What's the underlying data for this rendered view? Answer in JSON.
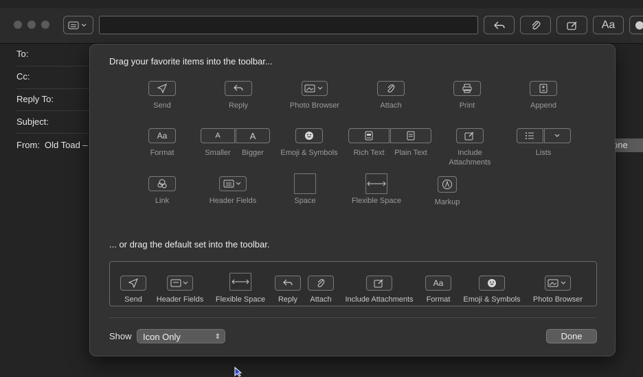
{
  "mail": {
    "headers": [
      {
        "label": "To:"
      },
      {
        "label": "Cc:"
      },
      {
        "label": "Reply To:"
      },
      {
        "label": "Subject:"
      },
      {
        "label": "From:",
        "value": "Old Toad –"
      }
    ],
    "right_partial": "one"
  },
  "sheet": {
    "title": "Drag your favorite items into the toolbar...",
    "items": [
      {
        "label": "Send",
        "icon": "send-icon"
      },
      {
        "label": "Reply",
        "icon": "reply-icon"
      },
      {
        "label": "Photo Browser",
        "icon": "photo-browser-icon"
      },
      {
        "label": "Attach",
        "icon": "paperclip-icon"
      },
      {
        "label": "Print",
        "icon": "printer-icon"
      },
      {
        "label": "Append",
        "icon": "append-icon"
      },
      {
        "label": "Format",
        "icon": "format-icon",
        "glyph": "Aa"
      },
      {
        "label": "Smaller",
        "icon": "smaller-font-icon",
        "glyph": "A"
      },
      {
        "label": "Bigger",
        "icon": "bigger-font-icon",
        "glyph": "A"
      },
      {
        "label": "Emoji & Symbols",
        "icon": "emoji-icon"
      },
      {
        "label": "Rich Text",
        "icon": "rich-text-icon"
      },
      {
        "label": "Plain Text",
        "icon": "plain-text-icon"
      },
      {
        "label": "Include\nAttachments",
        "label_line1": "Include",
        "label_line2": "Attachments",
        "icon": "include-attachments-icon"
      },
      {
        "label": "Lists",
        "icon": "list-icon"
      },
      {
        "label": "Link",
        "icon": "link-icon"
      },
      {
        "label": "Header Fields",
        "icon": "header-fields-icon"
      },
      {
        "label": "Space",
        "icon": "space-icon"
      },
      {
        "label": "Flexible Space",
        "icon": "flexible-space-icon"
      },
      {
        "label": "Markup",
        "icon": "markup-icon"
      }
    ],
    "default_title": "... or drag the default set into the toolbar.",
    "default_items": [
      {
        "label": "Send",
        "icon": "send-icon"
      },
      {
        "label": "Header Fields",
        "icon": "header-fields-icon"
      },
      {
        "label": "Flexible Space",
        "icon": "flexible-space-icon"
      },
      {
        "label": "Reply",
        "icon": "reply-icon"
      },
      {
        "label": "Attach",
        "icon": "paperclip-icon"
      },
      {
        "label": "Include Attachments",
        "icon": "include-attachments-icon"
      },
      {
        "label": "Format",
        "icon": "format-icon",
        "glyph": "Aa"
      },
      {
        "label": "Emoji & Symbols",
        "icon": "emoji-icon"
      },
      {
        "label": "Photo Browser",
        "icon": "photo-browser-icon"
      }
    ],
    "show_label": "Show",
    "show_value": "Icon Only",
    "done_label": "Done"
  },
  "toolbar": {
    "format_glyph": "Aa"
  }
}
